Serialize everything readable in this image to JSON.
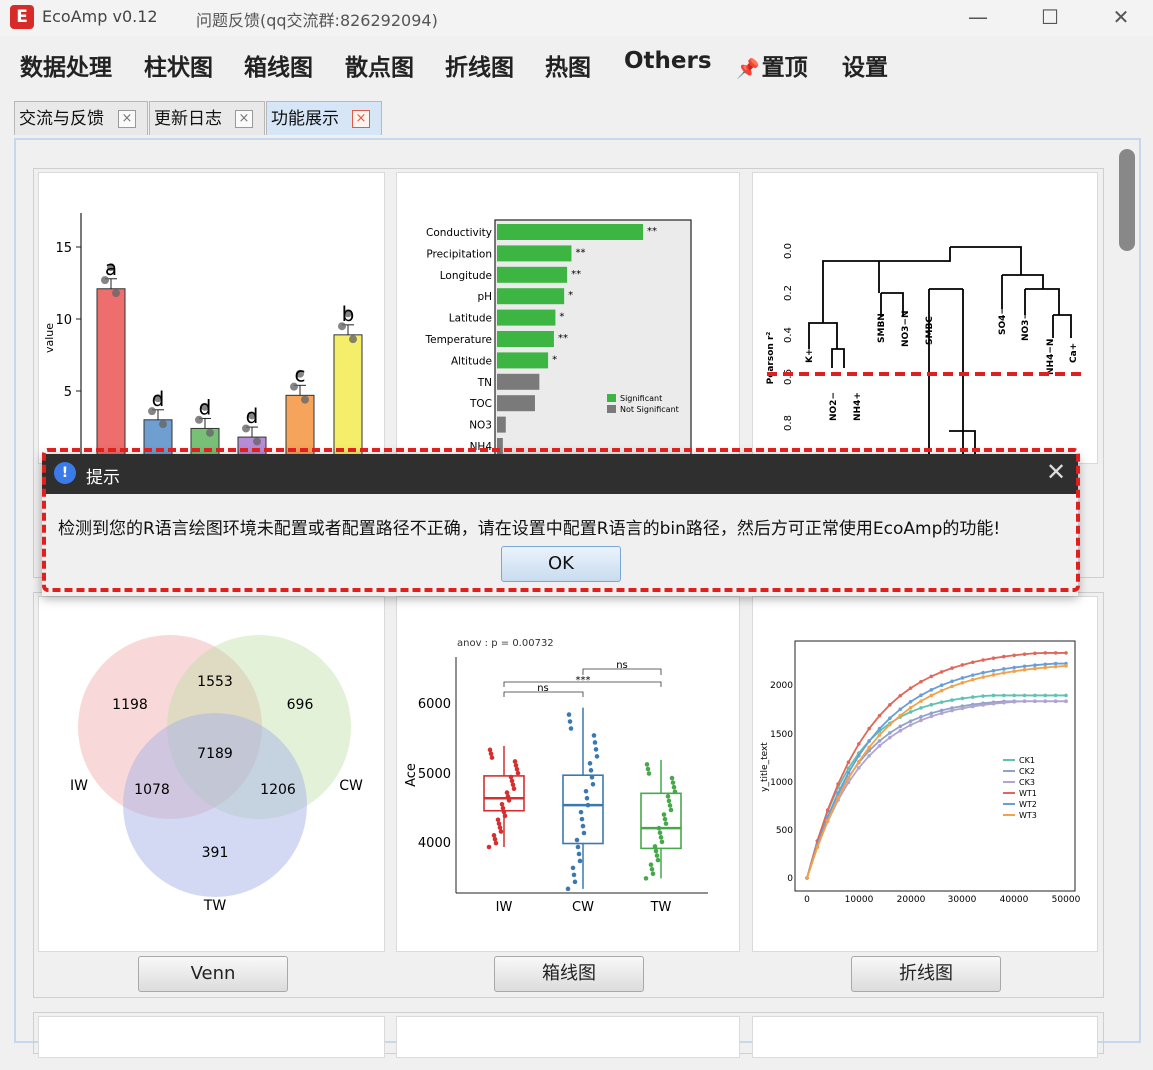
{
  "window": {
    "logo": "E",
    "title": "EcoAmp v0.12",
    "feedback": "问题反馈(qq交流群:826292094)",
    "minimize": "—",
    "maximize": "☐",
    "close": "✕"
  },
  "menu": {
    "items": [
      "数据处理",
      "柱状图",
      "箱线图",
      "散点图",
      "折线图",
      "热图",
      "Others"
    ],
    "pin_icon": "📌",
    "pin_label": "置顶",
    "settings": "设置"
  },
  "tabs": [
    {
      "label": "交流与反馈",
      "close": "×"
    },
    {
      "label": "更新日志",
      "close": "×"
    },
    {
      "label": "功能展示",
      "close": "×"
    }
  ],
  "bar_chart": {
    "ylabel": "value",
    "yticks": [
      "15",
      "10",
      "5"
    ],
    "letters": [
      "a",
      "d",
      "d",
      "d",
      "c",
      "b"
    ],
    "values": [
      12.1,
      3.0,
      2.4,
      1.8,
      4.7,
      8.9
    ],
    "colors": [
      "#ee6d6d",
      "#6f9fd1",
      "#78c078",
      "#b68cd6",
      "#f6a35b",
      "#f5ee6a"
    ]
  },
  "importance_chart": {
    "variables": [
      {
        "name": "Conductivity",
        "value": 100,
        "sig": "**",
        "significant": true
      },
      {
        "name": "Precipitation",
        "value": 51,
        "sig": "**",
        "significant": true
      },
      {
        "name": "Longitude",
        "value": 48,
        "sig": "**",
        "significant": true
      },
      {
        "name": "pH",
        "value": 46,
        "sig": "*",
        "significant": true
      },
      {
        "name": "Latitude",
        "value": 40,
        "sig": "*",
        "significant": true
      },
      {
        "name": "Temperature",
        "value": 39,
        "sig": "**",
        "significant": true
      },
      {
        "name": "Altitude",
        "value": 35,
        "sig": "*",
        "significant": true
      },
      {
        "name": "TN",
        "value": 29,
        "sig": "",
        "significant": false
      },
      {
        "name": "TOC",
        "value": 26,
        "sig": "",
        "significant": false
      },
      {
        "name": "NO3",
        "value": 6,
        "sig": "",
        "significant": false
      },
      {
        "name": "NH4",
        "value": 4,
        "sig": "",
        "significant": false
      }
    ],
    "legend": [
      "Significant",
      "Not Significant"
    ],
    "colors": {
      "significant": "#3db543",
      "not_significant": "#7a7a7a"
    }
  },
  "dendrogram": {
    "ylabel": "Pearson r²",
    "yticks": [
      "0.0",
      "0.2",
      "0.4",
      "0.6",
      "0.8"
    ],
    "leaves": [
      "K+",
      "NO2−",
      "NH4+",
      "SMBN",
      "NO3−N",
      "SMBC",
      "SO4−",
      "NO3−",
      "NH4−N",
      "Ca+"
    ]
  },
  "venn": {
    "labels": {
      "a": "IW",
      "b": "CW",
      "c": "TW"
    },
    "counts": {
      "a_only": "1198",
      "ab": "1553",
      "b_only": "696",
      "abc": "7189",
      "ac": "1078",
      "bc": "1206",
      "c_only": "391"
    },
    "button": "Venn"
  },
  "boxplot": {
    "stat": "anov : p = 0.00732",
    "ylabel": "Ace",
    "yticks": [
      "6000",
      "5000",
      "4000"
    ],
    "groups": [
      "IW",
      "CW",
      "TW"
    ],
    "sig": [
      "ns",
      "***",
      "ns"
    ],
    "colors": [
      "#d62f2f",
      "#3a78b0",
      "#46a84a"
    ],
    "button": "箱线图"
  },
  "rarefaction": {
    "ylabel": "y_title_text",
    "yticks": [
      "2000",
      "1500",
      "1000",
      "500",
      "0"
    ],
    "xticks": [
      "0",
      "10000",
      "20000",
      "30000",
      "40000",
      "50000"
    ],
    "series": [
      {
        "name": "CK1",
        "color": "#5fc2b0"
      },
      {
        "name": "CK2",
        "color": "#8fa3c9"
      },
      {
        "name": "CK3",
        "color": "#b3a3d1"
      },
      {
        "name": "WT1",
        "color": "#e0675a"
      },
      {
        "name": "WT2",
        "color": "#6b9ed6"
      },
      {
        "name": "WT3",
        "color": "#f2a24b"
      }
    ],
    "button": "折线图"
  },
  "dialog": {
    "icon": "!",
    "title": "提示",
    "close": "✕",
    "message": "检测到您的R语言绘图环境未配置或者配置路径不正确，请在设置中配置R语言的bin路径，然后方可正常使用EcoAmp的功能!",
    "ok": "OK"
  }
}
